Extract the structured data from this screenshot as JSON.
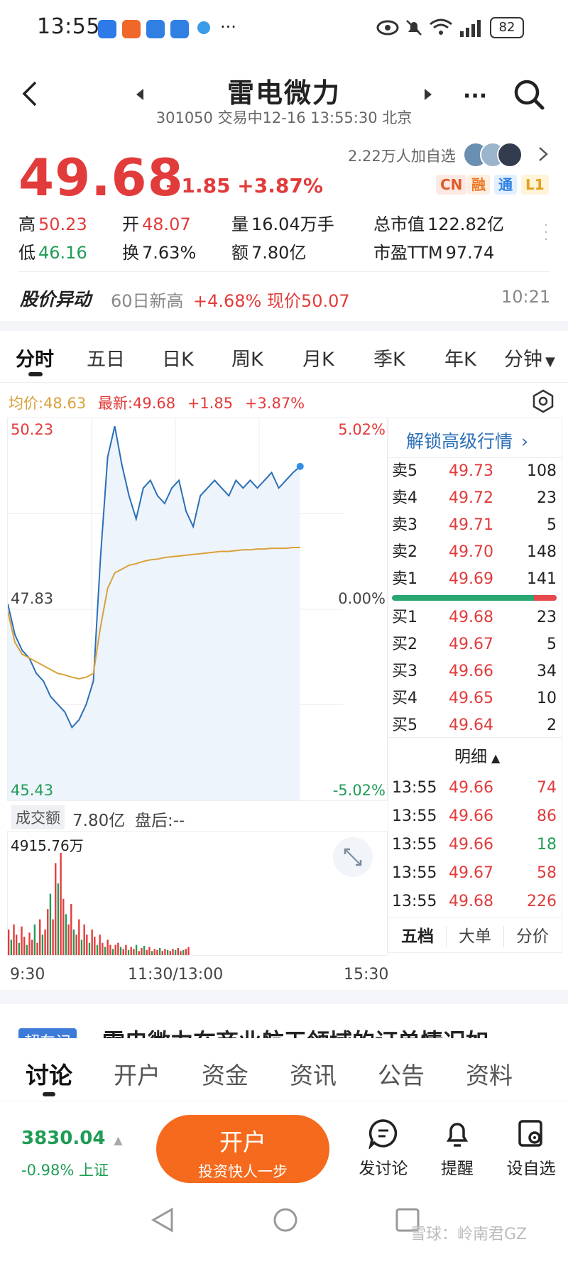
{
  "status_bar": {
    "time": "13:55",
    "battery": "82"
  },
  "header": {
    "title": "雷电微力",
    "subtitle": "301050 交易中12-16 13:55:30 北京"
  },
  "quote": {
    "price": "49.68",
    "change": "+1.85",
    "change_pct": "+3.87%",
    "watchers": "2.22万人加自选",
    "tags": [
      "CN",
      "融",
      "通",
      "L1"
    ],
    "stats": {
      "high_label": "高",
      "high": "50.23",
      "open_label": "开",
      "open": "48.07",
      "vol_label": "量",
      "vol": "16.04万手",
      "mcap_label": "总市值",
      "mcap": "122.82亿",
      "low_label": "低",
      "low": "46.16",
      "turnover_label": "换",
      "turnover": "7.63%",
      "amount_label": "额",
      "amount": "7.80亿",
      "pe_label": "市盈TTM",
      "pe": "97.74"
    }
  },
  "alert": {
    "label": "股价异动",
    "text_prefix": "60日新高",
    "text_value": "+4.68% 现价50.07",
    "time": "10:21"
  },
  "period_tabs": [
    "分时",
    "五日",
    "日K",
    "周K",
    "月K",
    "季K",
    "年K",
    "分钟"
  ],
  "chart_info": {
    "avg": "均价:48.63",
    "latest": "最新:49.68",
    "chg": "+1.85",
    "pct": "+3.87%"
  },
  "chart_data": {
    "type": "line",
    "series": [
      {
        "name": "最新",
        "values": [
          47.9,
          47.5,
          47.3,
          47.2,
          47.0,
          46.9,
          46.7,
          46.6,
          46.5,
          46.3,
          46.4,
          46.6,
          46.9,
          48.5,
          49.8,
          50.2,
          49.7,
          49.3,
          49.0,
          49.4,
          49.5,
          49.3,
          49.2,
          49.4,
          49.5,
          49.1,
          48.9,
          49.3,
          49.4,
          49.5,
          49.4,
          49.3,
          49.5,
          49.4,
          49.5,
          49.4,
          49.5,
          49.6,
          49.4,
          49.5,
          49.6,
          49.68
        ]
      },
      {
        "name": "均价",
        "values": [
          47.8,
          47.4,
          47.25,
          47.2,
          47.15,
          47.1,
          47.05,
          47.0,
          46.98,
          46.95,
          46.93,
          46.95,
          47.0,
          47.6,
          48.1,
          48.3,
          48.35,
          48.4,
          48.42,
          48.45,
          48.47,
          48.48,
          48.5,
          48.51,
          48.52,
          48.53,
          48.54,
          48.55,
          48.56,
          48.57,
          48.58,
          48.58,
          48.59,
          48.6,
          48.6,
          48.61,
          48.61,
          48.62,
          48.62,
          48.62,
          48.63,
          48.63
        ]
      }
    ],
    "ylim": [
      45.43,
      50.23
    ],
    "y_ticks": [
      "50.23",
      "47.83",
      "45.43"
    ],
    "pct_ticks": [
      "5.02%",
      "0.00%",
      "-5.02%"
    ],
    "x_ticks": [
      "9:30",
      "11:30/13:00",
      "15:30"
    ],
    "volume": {
      "label": "成交额",
      "total": "7.80亿",
      "after": "盘后:--",
      "max_label": "4915.76万",
      "values": [
        0.25,
        0.15,
        0.3,
        0.2,
        0.12,
        0.28,
        0.18,
        0.1,
        0.22,
        0.15,
        0.3,
        0.12,
        0.35,
        0.2,
        0.25,
        0.45,
        0.6,
        0.35,
        0.9,
        0.7,
        1.0,
        0.55,
        0.4,
        0.3,
        0.5,
        0.25,
        0.2,
        0.35,
        0.15,
        0.3,
        0.2,
        0.12,
        0.25,
        0.18,
        0.1,
        0.2,
        0.12,
        0.08,
        0.15,
        0.1,
        0.06,
        0.1,
        0.12,
        0.08,
        0.06,
        0.1,
        0.05,
        0.08,
        0.06,
        0.1,
        0.04,
        0.07,
        0.09,
        0.05,
        0.08,
        0.04,
        0.06,
        0.05,
        0.07,
        0.04,
        0.06,
        0.05,
        0.04,
        0.06,
        0.05,
        0.07,
        0.04,
        0.05,
        0.06,
        0.08
      ]
    }
  },
  "order_book": {
    "unlock": "解锁高级行情",
    "sells": [
      {
        "label": "卖5",
        "price": "49.73",
        "qty": "108"
      },
      {
        "label": "卖4",
        "price": "49.72",
        "qty": "23"
      },
      {
        "label": "卖3",
        "price": "49.71",
        "qty": "5"
      },
      {
        "label": "卖2",
        "price": "49.70",
        "qty": "148"
      },
      {
        "label": "卖1",
        "price": "49.69",
        "qty": "141"
      }
    ],
    "buys": [
      {
        "label": "买1",
        "price": "49.68",
        "qty": "23"
      },
      {
        "label": "买2",
        "price": "49.67",
        "qty": "5"
      },
      {
        "label": "买3",
        "price": "49.66",
        "qty": "34"
      },
      {
        "label": "买4",
        "price": "49.65",
        "qty": "10"
      },
      {
        "label": "买5",
        "price": "49.64",
        "qty": "2"
      }
    ],
    "detail_label": "明细",
    "trades": [
      {
        "time": "13:55",
        "price": "49.66",
        "qty": "74",
        "side": "sell"
      },
      {
        "time": "13:55",
        "price": "49.66",
        "qty": "86",
        "side": "sell"
      },
      {
        "time": "13:55",
        "price": "49.66",
        "qty": "18",
        "side": "buy"
      },
      {
        "time": "13:55",
        "price": "49.67",
        "qty": "58",
        "side": "sell"
      },
      {
        "time": "13:55",
        "price": "49.68",
        "qty": "226",
        "side": "sell"
      }
    ],
    "bottom_tabs": [
      "五档",
      "大单",
      "分价"
    ]
  },
  "news_peek": {
    "badge": "超车记",
    "text": "雷电微力在商业航天领域的订单情况如"
  },
  "bottom_tabs": [
    "讨论",
    "开户",
    "资金",
    "资讯",
    "公告",
    "资料"
  ],
  "index": {
    "value": "3830.04",
    "change": "-0.98% 上证"
  },
  "cta": {
    "title": "开户",
    "subtitle": "投资快人一步"
  },
  "actions": [
    "发讨论",
    "提醒",
    "设自选"
  ],
  "watermark": "雪球：岭南君GZ",
  "colors": {
    "up": "#e23b3b",
    "down": "#1f9d55",
    "price_line": "#2b6fb6",
    "avg_line": "#d9a13b",
    "cta": "#f56a1c"
  }
}
